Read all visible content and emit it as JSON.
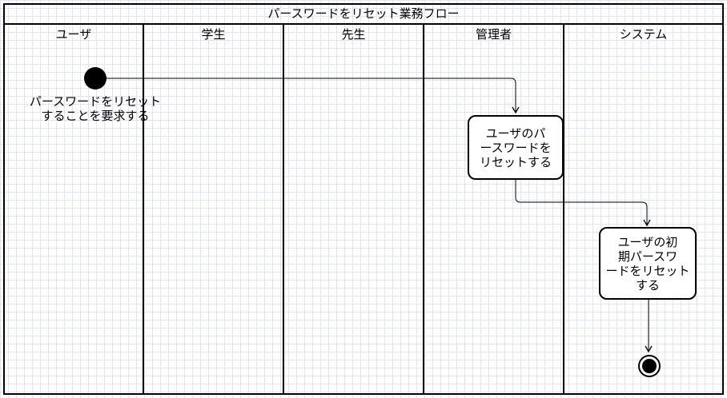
{
  "diagram": {
    "title": "パースワードをリセット業務フロー",
    "lanes": [
      "ユーザ",
      "学生",
      "先生",
      "管理者",
      "システム"
    ],
    "start_label": "パースワードをリセットすることを要求する",
    "start_label_lines": [
      "パースワードをリセット",
      "することを要求する"
    ],
    "actions": [
      {
        "label": "ユーザのパースワードをリセットする",
        "lines": [
          "ユーザのパ",
          "ースワードを",
          "リセットする"
        ]
      },
      {
        "label": "ユーザの初期パースワードをリセットする",
        "lines": [
          "ユーザの初",
          "期パースワ",
          "ードをリセット",
          "する"
        ]
      }
    ]
  }
}
